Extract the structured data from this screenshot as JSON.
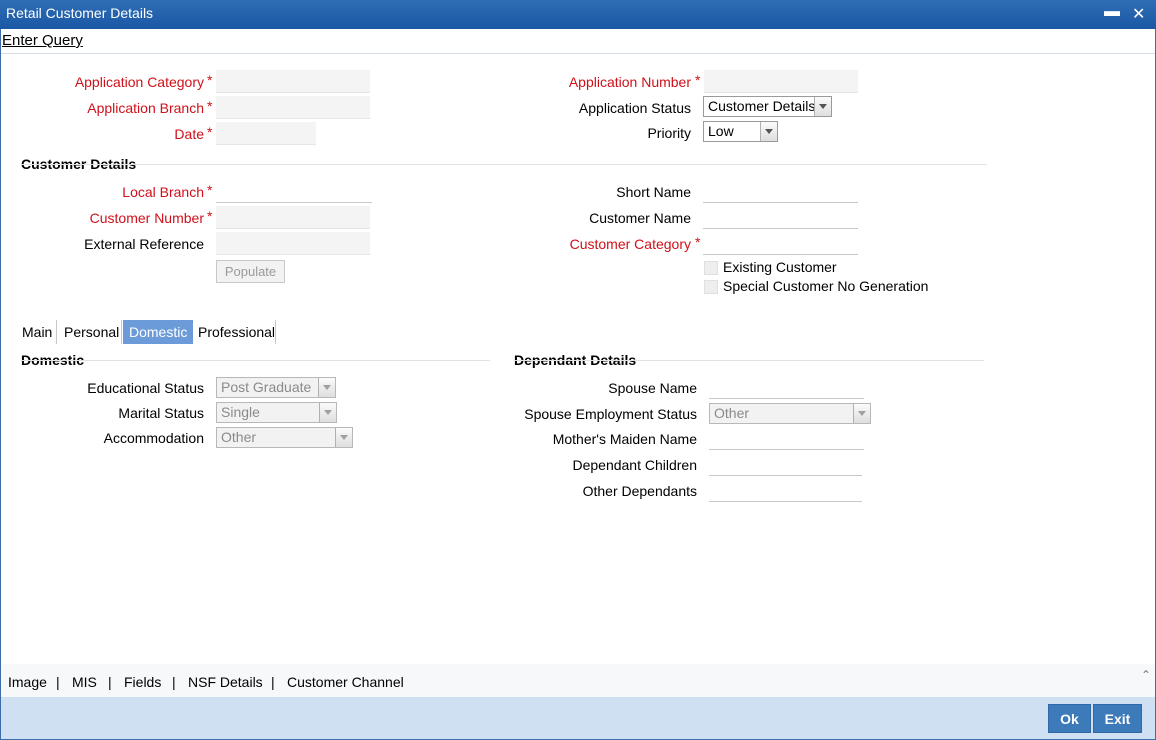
{
  "window": {
    "title": "Retail Customer Details",
    "minimize_icon": "minimize-icon",
    "close_icon": "close-icon"
  },
  "toolbar": {
    "enter_query": "Enter Query"
  },
  "header": {
    "application_category": {
      "label": "Application Category",
      "value": ""
    },
    "application_branch": {
      "label": "Application Branch",
      "value": ""
    },
    "date": {
      "label": "Date",
      "value": ""
    },
    "application_number": {
      "label": "Application Number",
      "value": ""
    },
    "application_status": {
      "label": "Application Status",
      "selected": "Customer Details"
    },
    "priority": {
      "label": "Priority",
      "selected": "Low"
    }
  },
  "customer_details": {
    "title": "Customer Details",
    "local_branch": {
      "label": "Local Branch",
      "value": ""
    },
    "customer_number": {
      "label": "Customer Number",
      "value": ""
    },
    "external_reference": {
      "label": "External Reference",
      "value": ""
    },
    "populate_label": "Populate",
    "short_name": {
      "label": "Short Name",
      "value": ""
    },
    "customer_name": {
      "label": "Customer Name",
      "value": ""
    },
    "customer_category": {
      "label": "Customer Category",
      "value": ""
    },
    "existing_customer": {
      "label": "Existing Customer",
      "checked": false
    },
    "special_customer_no": {
      "label": "Special Customer No Generation",
      "checked": false
    }
  },
  "required_mark": "*",
  "tabs": [
    {
      "label": "Main",
      "active": false
    },
    {
      "label": "Personal",
      "active": false
    },
    {
      "label": "Domestic",
      "active": true
    },
    {
      "label": "Professional",
      "active": false
    }
  ],
  "domestic": {
    "title": "Domestic",
    "educational_status": {
      "label": "Educational Status",
      "selected": "Post Graduate"
    },
    "marital_status": {
      "label": "Marital Status",
      "selected": "Single"
    },
    "accommodation": {
      "label": "Accommodation",
      "selected": "Other"
    }
  },
  "dependant": {
    "title": "Dependant Details",
    "spouse_name": {
      "label": "Spouse Name",
      "value": ""
    },
    "spouse_employment_status": {
      "label": "Spouse Employment Status",
      "selected": "Other"
    },
    "mothers_maiden_name": {
      "label": "Mother's Maiden Name",
      "value": ""
    },
    "dependant_children": {
      "label": "Dependant Children",
      "value": ""
    },
    "other_dependants": {
      "label": "Other Dependants",
      "value": ""
    }
  },
  "bottom_links": [
    "Image",
    "MIS",
    "Fields",
    "NSF Details",
    "Customer Channel"
  ],
  "bottom_separator": "|",
  "footer": {
    "ok_label": "Ok",
    "exit_label": "Exit"
  },
  "colors": {
    "titlebar": "#1f5fae",
    "required": "#d0101a",
    "active_tab": "#6b9bd8",
    "footer": "#cfe0f2",
    "button": "#3d7ab9"
  }
}
